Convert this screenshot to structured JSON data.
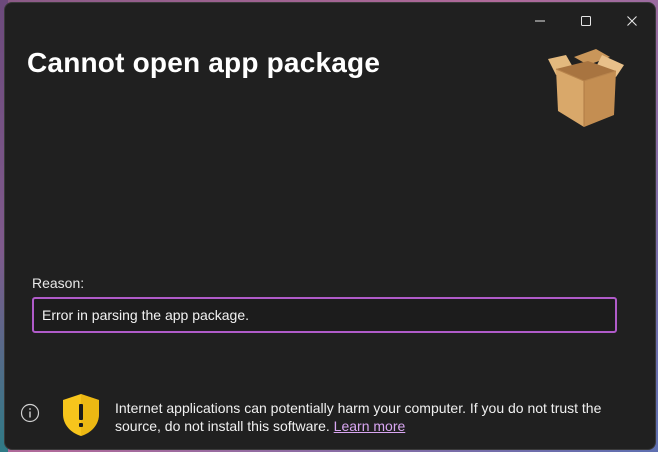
{
  "window": {
    "title": "Cannot open app package",
    "controls": [
      {
        "name": "minimize",
        "icon": "minimize-icon"
      },
      {
        "name": "maximize",
        "icon": "maximize-icon"
      },
      {
        "name": "close",
        "icon": "close-icon"
      }
    ]
  },
  "header_icon": "package-box-icon",
  "reason": {
    "label": "Reason:",
    "value": "Error in parsing the app package."
  },
  "footer": {
    "info_icon": "info-icon",
    "warning_icon": "shield-warning-icon",
    "warning_text": "Internet applications can potentially harm your computer. If you do not trust the source, do not install this software.",
    "learn_more_label": "Learn more"
  },
  "colors": {
    "background": "#202020",
    "field_border": "#b05bc9",
    "link": "#d9a6f2",
    "shield": "#f7c51c"
  }
}
